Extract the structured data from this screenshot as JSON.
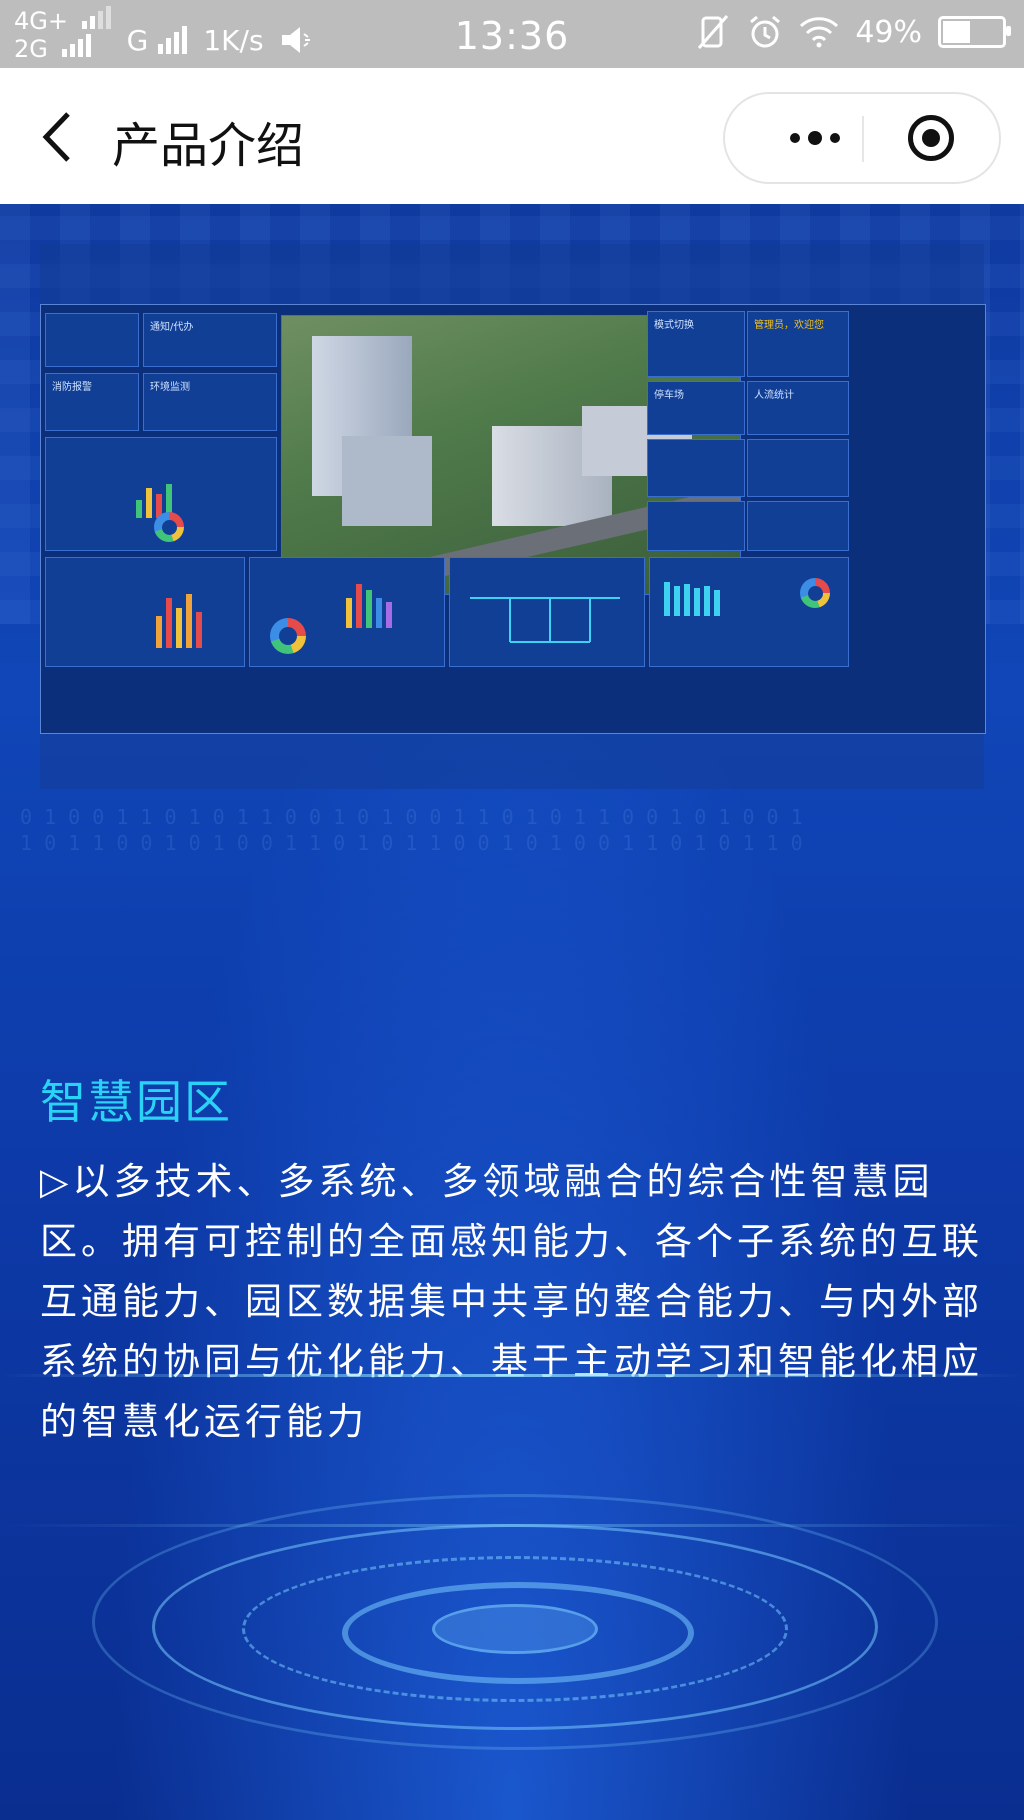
{
  "status_bar": {
    "network_line1": "4G+",
    "network_line2": "2G",
    "carrier": "G",
    "speed": "1K/s",
    "time": "13:36",
    "battery_percent": "49%",
    "battery_level": 0.49
  },
  "nav": {
    "title": "产品介绍"
  },
  "section": {
    "heading": "智慧园区",
    "description": "▷以多技术、多系统、多领域融合的综合性智慧园区。拥有可控制的全面感知能力、各个子系统的互联互通能力、园区数据集中共享的整合能力、与内外部系统的协同与优化能力、基于主动学习和智能化相应的智慧化运行能力"
  },
  "dashboard": {
    "labels": {
      "notice": "通知/代办",
      "fire_alarm": "消防报警",
      "env_monitor": "环境监测",
      "mode_switch": "模式切换",
      "admin_welcome": "管理员，欢迎您",
      "parking": "停车场",
      "people_stats": "人流统计"
    },
    "colors": {
      "accent_cyan": "#2ad3f5",
      "admin_yellow": "#f3c21a"
    }
  }
}
